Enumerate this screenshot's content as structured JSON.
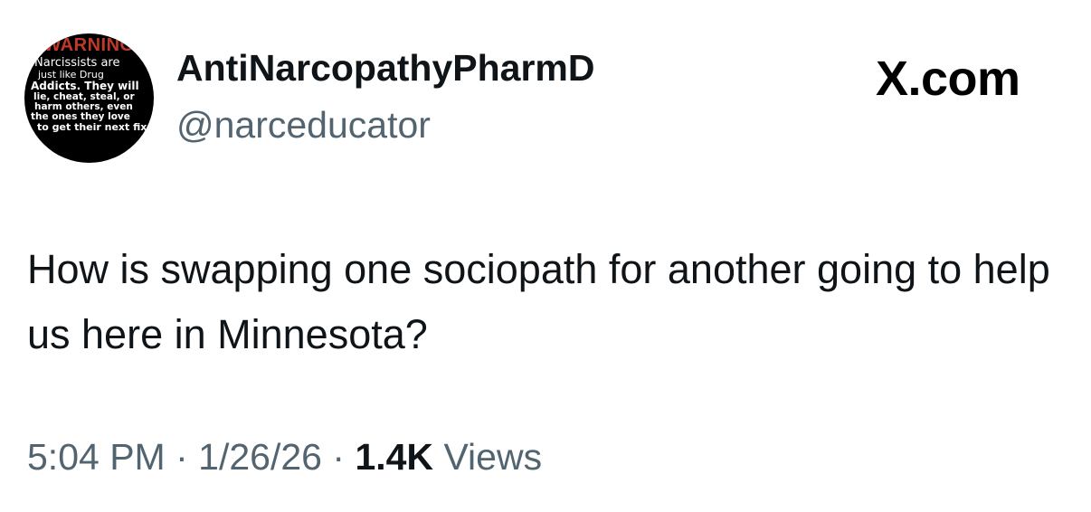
{
  "author": {
    "display_name": "AntiNarcopathyPharmD",
    "handle": "@narceducator",
    "avatar_text": {
      "warning": "WARNING",
      "line1": "Narcissists are",
      "line2": "just like Drug",
      "line3": "Addicts. They will",
      "line4": "lie, cheat, steal, or",
      "line5": "harm others, even",
      "line6": "the ones they love",
      "line7": "to get their next fix"
    }
  },
  "brand": "X.com",
  "tweet": {
    "text": "How is swapping one sociopath for another going to help us here in Minnesota?"
  },
  "meta": {
    "time": "5:04 PM",
    "separator": "·",
    "date": "1/26/26",
    "views_count": "1.4K",
    "views_label": "Views"
  }
}
